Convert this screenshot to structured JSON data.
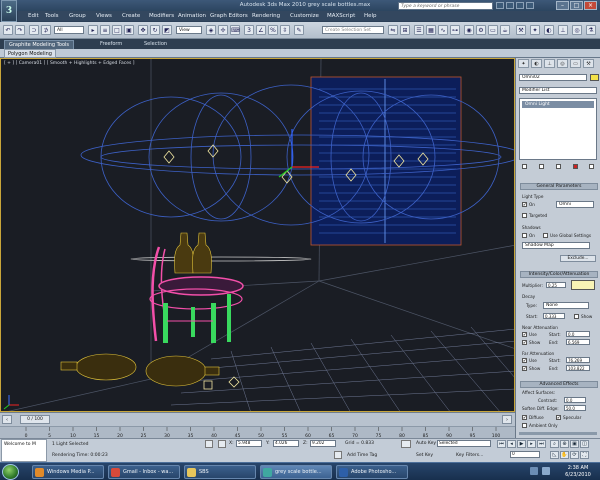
{
  "title_bar": {
    "app_title": "Autodesk 3ds Max  2010    grey scale bottles.max",
    "search_placeholder": "Type a keyword or phrase",
    "logo": "3"
  },
  "menu": [
    "Edit",
    "Tools",
    "Group",
    "Views",
    "Create",
    "Modifiers",
    "Animation",
    "Graph Editors",
    "Rendering",
    "Customize",
    "MAXScript",
    "Help"
  ],
  "toolbar": {
    "selection_filter": "All",
    "reference_coord": "View",
    "named_selection": "Create Selection Set"
  },
  "ribbon": {
    "tabs": [
      "Graphite Modeling Tools",
      "Freeform",
      "Selection"
    ],
    "panel": "Polygon Modeling"
  },
  "viewport": {
    "label": "[ + ] [ Camera01 ] [ Smooth + Highlights + Edged Faces ]"
  },
  "command_panel": {
    "object_name": "Omni02",
    "color_hex": "#f3e24a",
    "modifier_list": "Modifier List",
    "stack_item": "Omni Light",
    "rollouts": {
      "general": "General Parameters",
      "light_type_label": "Light Type",
      "on_label": "On",
      "light_type": "Omni",
      "targeted_label": "Targeted",
      "shadows_label": "Shadows",
      "use_global": "Use Global Settings",
      "shadow_type": "Shadow Map",
      "exclude": "Exclude...",
      "intensity": "Intensity/Color/Attenuation",
      "multiplier_label": "Multiplier:",
      "multiplier": "0.25",
      "light_color_hex": "#f8f3b5",
      "decay_label": "Decay",
      "type_label": "Type:",
      "decay_type": "None",
      "start_label": "Start:",
      "decay_start": "0.333",
      "show_label": "Show",
      "near_atten": "Near Attenuation",
      "use_label": "Use",
      "near_start": "0.0",
      "end_label": "End:",
      "near_end": "6.569",
      "far_atten": "Far Attenuation",
      "far_start": "76.269",
      "far_end": "103.822",
      "advanced": "Advanced Effects",
      "affect_surfaces": "Affect Surfaces:",
      "contrast_label": "Contrast:",
      "contrast": "0.0",
      "soften_label": "Soften Diff. Edge:",
      "soften": "50.0",
      "diffuse_label": "Diffuse",
      "specular_label": "Specular",
      "ambient_label": "Ambient Only"
    }
  },
  "timeline": {
    "frame_counter": "0 / 100",
    "ticks": [
      "0",
      "5",
      "10",
      "15",
      "20",
      "25",
      "30",
      "35",
      "40",
      "45",
      "50",
      "55",
      "60",
      "65",
      "70",
      "75",
      "80",
      "85",
      "90",
      "95",
      "100"
    ]
  },
  "status": {
    "welcome": "Welcome to M",
    "selection": "1 Light Selected",
    "render_time": "Rendering Time: 0:00:23",
    "x_label": "X:",
    "x": "5.948",
    "y_label": "Y:",
    "y": "4.026",
    "z_label": "Z:",
    "z": "9.202",
    "grid": "Grid = 0.833",
    "add_time_tag": "Add Time Tag",
    "auto_key": "Auto Key",
    "auto_key_dropdown": "Selected",
    "set_key": "Set Key",
    "key_filters": "Key Filters...",
    "frame": "0"
  },
  "taskbar": {
    "items": [
      {
        "label": "Windows Media P...",
        "color": "#e08a2a"
      },
      {
        "label": "Gmail - Inbox - wa...",
        "color": "#d84a3a"
      },
      {
        "label": "SBS",
        "color": "#e7c65b"
      },
      {
        "label": "grey scale bottle...",
        "color": "#3fa8a0"
      },
      {
        "label": "Adobe Photosho...",
        "color": "#2d5fa8"
      }
    ],
    "time": "2:38 AM",
    "date": "6/23/2010"
  }
}
